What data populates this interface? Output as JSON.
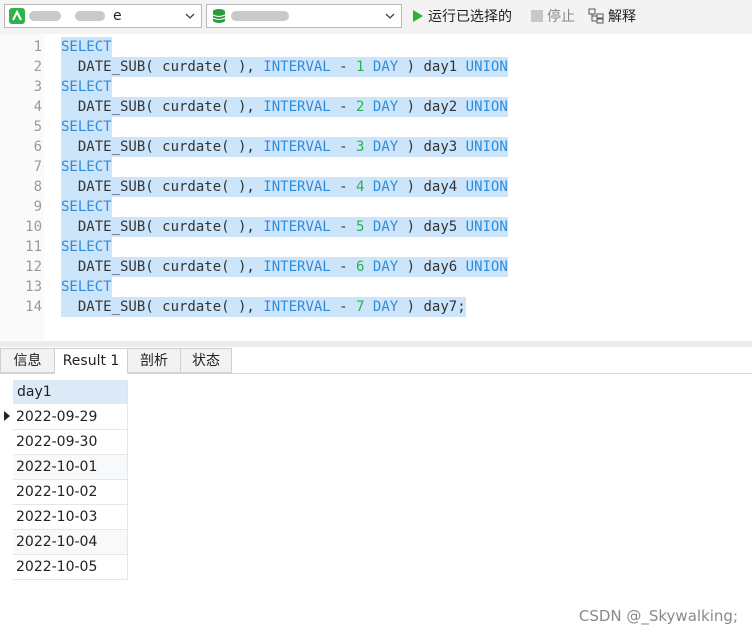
{
  "toolbar": {
    "connection_combo": {
      "visible_text": "e",
      "icon": "navicat-connection-icon"
    },
    "database_combo": {
      "visible_text": "",
      "icon": "database-icon"
    },
    "run_selected_label": "运行已选择的",
    "stop_label": "停止",
    "explain_label": "解释",
    "colors": {
      "run_green": "#2fb02f",
      "db_green": "#2a9d3a"
    }
  },
  "editor": {
    "line_numbers": [
      "1",
      "2",
      "3",
      "4",
      "5",
      "6",
      "7",
      "8",
      "9",
      "10",
      "11",
      "12",
      "13",
      "14"
    ],
    "lines": [
      [
        {
          "t": "SELECT",
          "k": "kw"
        }
      ],
      [
        {
          "t": "  DATE_SUB( curdate( ), "
        },
        {
          "t": "INTERVAL",
          "k": "kw"
        },
        {
          "t": " - "
        },
        {
          "t": "1",
          "k": "num"
        },
        {
          "t": " "
        },
        {
          "t": "DAY",
          "k": "kw"
        },
        {
          "t": " ) day1 "
        },
        {
          "t": "UNION",
          "k": "kw"
        }
      ],
      [
        {
          "t": "SELECT",
          "k": "kw"
        }
      ],
      [
        {
          "t": "  DATE_SUB( curdate( ), "
        },
        {
          "t": "INTERVAL",
          "k": "kw"
        },
        {
          "t": " - "
        },
        {
          "t": "2",
          "k": "num"
        },
        {
          "t": " "
        },
        {
          "t": "DAY",
          "k": "kw"
        },
        {
          "t": " ) day2 "
        },
        {
          "t": "UNION",
          "k": "kw"
        }
      ],
      [
        {
          "t": "SELECT",
          "k": "kw"
        }
      ],
      [
        {
          "t": "  DATE_SUB( curdate( ), "
        },
        {
          "t": "INTERVAL",
          "k": "kw"
        },
        {
          "t": " - "
        },
        {
          "t": "3",
          "k": "num"
        },
        {
          "t": " "
        },
        {
          "t": "DAY",
          "k": "kw"
        },
        {
          "t": " ) day3 "
        },
        {
          "t": "UNION",
          "k": "kw"
        }
      ],
      [
        {
          "t": "SELECT",
          "k": "kw"
        }
      ],
      [
        {
          "t": "  DATE_SUB( curdate( ), "
        },
        {
          "t": "INTERVAL",
          "k": "kw"
        },
        {
          "t": " - "
        },
        {
          "t": "4",
          "k": "num"
        },
        {
          "t": " "
        },
        {
          "t": "DAY",
          "k": "kw"
        },
        {
          "t": " ) day4 "
        },
        {
          "t": "UNION",
          "k": "kw"
        }
      ],
      [
        {
          "t": "SELECT",
          "k": "kw"
        }
      ],
      [
        {
          "t": "  DATE_SUB( curdate( ), "
        },
        {
          "t": "INTERVAL",
          "k": "kw"
        },
        {
          "t": " - "
        },
        {
          "t": "5",
          "k": "num"
        },
        {
          "t": " "
        },
        {
          "t": "DAY",
          "k": "kw"
        },
        {
          "t": " ) day5 "
        },
        {
          "t": "UNION",
          "k": "kw"
        }
      ],
      [
        {
          "t": "SELECT",
          "k": "kw"
        }
      ],
      [
        {
          "t": "  DATE_SUB( curdate( ), "
        },
        {
          "t": "INTERVAL",
          "k": "kw"
        },
        {
          "t": " - "
        },
        {
          "t": "6",
          "k": "num"
        },
        {
          "t": " "
        },
        {
          "t": "DAY",
          "k": "kw"
        },
        {
          "t": " ) day6 "
        },
        {
          "t": "UNION",
          "k": "kw"
        }
      ],
      [
        {
          "t": "SELECT",
          "k": "kw"
        }
      ],
      [
        {
          "t": "  DATE_SUB( curdate( ), "
        },
        {
          "t": "INTERVAL",
          "k": "kw"
        },
        {
          "t": " - "
        },
        {
          "t": "7",
          "k": "num"
        },
        {
          "t": " "
        },
        {
          "t": "DAY",
          "k": "kw"
        },
        {
          "t": " ) day7;"
        }
      ]
    ],
    "colors": {
      "keyword": "#2f8cdd",
      "number": "#28b24a",
      "selection": "#cce5fb"
    }
  },
  "tabs": [
    {
      "label": "信息",
      "active": false
    },
    {
      "label": "Result 1",
      "active": true
    },
    {
      "label": "剖析",
      "active": false
    },
    {
      "label": "状态",
      "active": false
    }
  ],
  "result": {
    "columns": [
      "day1"
    ],
    "rows": [
      "2022-09-29",
      "2022-09-30",
      "2022-10-01",
      "2022-10-02",
      "2022-10-03",
      "2022-10-04",
      "2022-10-05"
    ],
    "current_row": 0
  },
  "watermark": "CSDN @_Skywalking;"
}
